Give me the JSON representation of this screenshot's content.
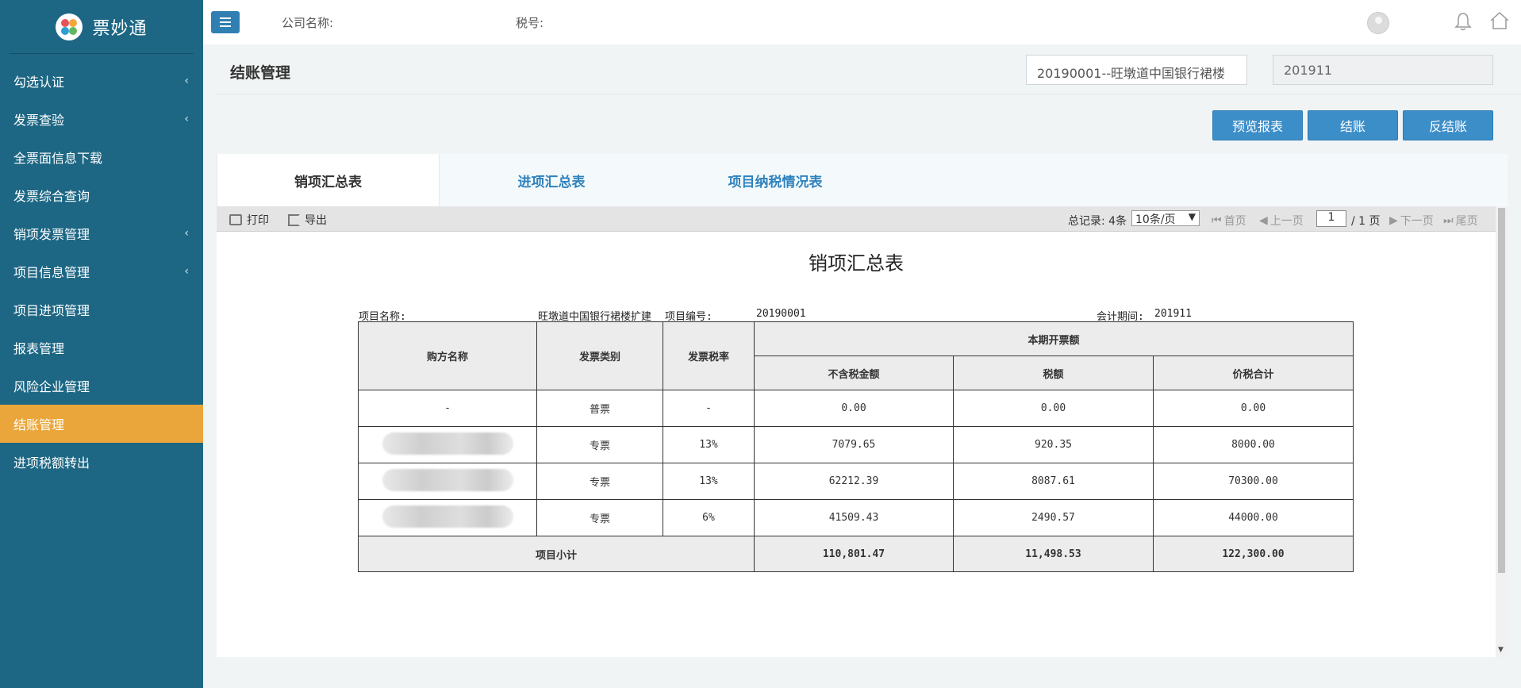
{
  "app": {
    "name": "票妙通"
  },
  "sidebar": {
    "items": [
      {
        "label": "勾选认证",
        "has_children": true
      },
      {
        "label": "发票查验",
        "has_children": true
      },
      {
        "label": "全票面信息下载",
        "has_children": false
      },
      {
        "label": "发票综合查询",
        "has_children": false
      },
      {
        "label": "销项发票管理",
        "has_children": true
      },
      {
        "label": "项目信息管理",
        "has_children": true
      },
      {
        "label": "项目进项管理",
        "has_children": false
      },
      {
        "label": "报表管理",
        "has_children": false
      },
      {
        "label": "风险企业管理",
        "has_children": false
      },
      {
        "label": "结账管理",
        "has_children": false,
        "active": true
      },
      {
        "label": "进项税额转出",
        "has_children": false
      }
    ]
  },
  "topbar": {
    "company_label": "公司名称:",
    "tax_label": "税号:"
  },
  "page": {
    "title": "结账管理",
    "project_select": "20190001--旺墩道中国银行裙楼",
    "period": "201911"
  },
  "actions": {
    "preview": "预览报表",
    "close": "结账",
    "reverse": "反结账"
  },
  "tabs": [
    {
      "label": "销项汇总表",
      "active": true
    },
    {
      "label": "进项汇总表",
      "active": false
    },
    {
      "label": "项目纳税情况表",
      "active": false
    }
  ],
  "toolbar": {
    "print": "打印",
    "export": "导出",
    "total_label": "总记录: 4条",
    "page_size": "10条/页",
    "first": "首页",
    "prev": "上一页",
    "page_current": "1",
    "page_total": "/ 1 页",
    "next": "下一页",
    "last": "尾页"
  },
  "report": {
    "title": "销项汇总表",
    "project_name_label": "项目名称:",
    "project_name": "旺墩道中国银行裙楼扩建",
    "project_no_label": "项目编号:",
    "project_no": "20190001",
    "period_label": "会计期间:",
    "period": "201911",
    "headers": {
      "buyer": "购方名称",
      "type": "发票类别",
      "rate": "发票税率",
      "group": "本期开票额",
      "amount": "不含税金额",
      "tax": "税额",
      "total": "价税合计"
    },
    "rows": [
      {
        "buyer": "-",
        "type": "普票",
        "rate": "-",
        "amount": "0.00",
        "tax": "0.00",
        "total": "0.00"
      },
      {
        "buyer": "",
        "type": "专票",
        "rate": "13%",
        "amount": "7079.65",
        "tax": "920.35",
        "total": "8000.00"
      },
      {
        "buyer": "",
        "type": "专票",
        "rate": "13%",
        "amount": "62212.39",
        "tax": "8087.61",
        "total": "70300.00"
      },
      {
        "buyer": "",
        "type": "专票",
        "rate": "6%",
        "amount": "41509.43",
        "tax": "2490.57",
        "total": "44000.00"
      }
    ],
    "subtotal": {
      "label": "项目小计",
      "amount": "110,801.47",
      "tax": "11,498.53",
      "total": "122,300.00"
    }
  }
}
